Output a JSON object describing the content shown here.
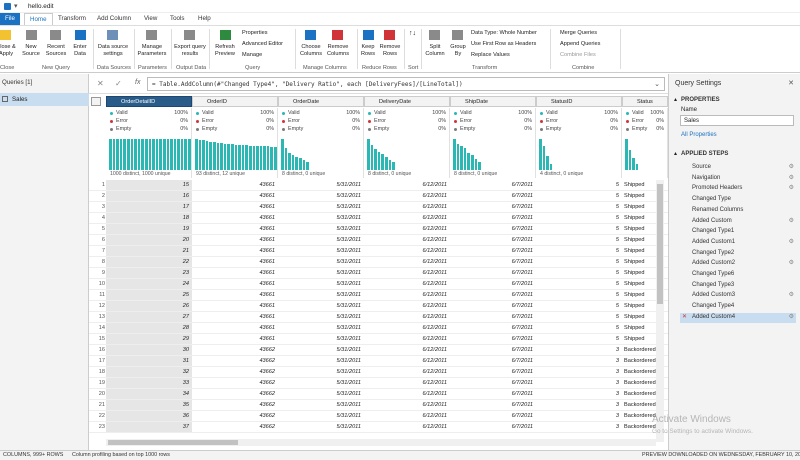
{
  "title": "hello.edit",
  "tabs": [
    "File",
    "Home",
    "Transform",
    "Add Column",
    "View",
    "Tools",
    "Help"
  ],
  "ribbon": {
    "buttons": [
      {
        "id": "close-apply",
        "label": "Close &\nApply"
      },
      {
        "id": "new-source",
        "label": "New\nSource"
      },
      {
        "id": "recent-sources",
        "label": "Recent\nSources"
      },
      {
        "id": "enter-data",
        "label": "Enter\nData"
      },
      {
        "id": "data-source-settings",
        "label": "Data source\nsettings"
      },
      {
        "id": "manage-parameters",
        "label": "Manage\nParameters"
      },
      {
        "id": "refresh-preview",
        "label": "Refresh\nPreview"
      },
      {
        "id": "export-query",
        "label": "Export query\nresults"
      },
      {
        "id": "choose-columns",
        "label": "Choose\nColumns"
      },
      {
        "id": "remove-columns",
        "label": "Remove\nColumns"
      },
      {
        "id": "keep-rows",
        "label": "Keep\nRows"
      },
      {
        "id": "remove-rows",
        "label": "Remove\nRows"
      },
      {
        "id": "split-column",
        "label": "Split\nColumn"
      },
      {
        "id": "group-by",
        "label": "Group\nBy"
      }
    ],
    "small": {
      "properties": "Properties",
      "advanced_editor": "Advanced Editor",
      "manage": "Manage",
      "data_type": "Data Type: Whole Number",
      "first_row": "Use First Row as Headers",
      "replace_values": "Replace Values",
      "merge": "Merge Queries",
      "append": "Append Queries",
      "combine_files": "Combine Files"
    },
    "groups": [
      "Close",
      "New Query",
      "Data Sources",
      "Parameters",
      "Output Data",
      "Query",
      "Manage Columns",
      "Reduce Rows",
      "Sort",
      "Transform",
      "Combine"
    ]
  },
  "queries": {
    "header": "Queries [1]",
    "items": [
      "Sales"
    ]
  },
  "formula": "= Table.AddColumn(#\"Changed Type4\", \"Delivery Ratio\", each [DeliveryFees]/[LineTotal])",
  "columns": [
    {
      "name": "OrderDetailID",
      "valid": "100%",
      "error": "0%",
      "empty": "0%",
      "foot": "1000 distinct, 1000 unique"
    },
    {
      "name": "OrderID",
      "valid": "100%",
      "error": "0%",
      "empty": "0%",
      "foot": "93 distinct, 12 unique"
    },
    {
      "name": "OrderDate",
      "valid": "100%",
      "error": "0%",
      "empty": "0%",
      "foot": "8 distinct, 0 unique"
    },
    {
      "name": "DeliveryDate",
      "valid": "100%",
      "error": "0%",
      "empty": "0%",
      "foot": "8 distinct, 0 unique"
    },
    {
      "name": "ShipDate",
      "valid": "100%",
      "error": "0%",
      "empty": "0%",
      "foot": "8 distinct, 0 unique"
    },
    {
      "name": "StatusID",
      "valid": "100%",
      "error": "0%",
      "empty": "0%",
      "foot": "4 distinct, 0 unique"
    },
    {
      "name": "Status",
      "valid": "100%",
      "error": "0%",
      "empty": "0%",
      "foot": "4 distinct, 0 unique"
    }
  ],
  "profile_labels": {
    "valid": "Valid",
    "error": "Error",
    "empty": "Empty"
  },
  "colors": {
    "valid": "#2bb7b3",
    "error": "#d13438",
    "empty": "#7a7a7a",
    "accent": "#1b72c2"
  },
  "histograms": [
    [
      31,
      31,
      31,
      31,
      31,
      31,
      31,
      31,
      31,
      31,
      31,
      31,
      31,
      31,
      31,
      31,
      31,
      31,
      31,
      31,
      31,
      31,
      31
    ],
    [
      31,
      30,
      30,
      29,
      28,
      28,
      27,
      27,
      26,
      26,
      26,
      25,
      25,
      25,
      25,
      24,
      24,
      24,
      24,
      24,
      24,
      23,
      23
    ],
    [
      31,
      22,
      17,
      15,
      13,
      12,
      10,
      8
    ],
    [
      31,
      25,
      21,
      18,
      16,
      13,
      10,
      8
    ],
    [
      31,
      26,
      24,
      22,
      17,
      15,
      11,
      8
    ],
    [
      31,
      24,
      14,
      6
    ],
    [
      31,
      20,
      12,
      6
    ]
  ],
  "rows": [
    [
      "15",
      "43661",
      "5/31/2011",
      "6/12/2011",
      "6/7/2011",
      "5",
      "Shipped"
    ],
    [
      "16",
      "43661",
      "5/31/2011",
      "6/12/2011",
      "6/7/2011",
      "5",
      "Shipped"
    ],
    [
      "17",
      "43661",
      "5/31/2011",
      "6/12/2011",
      "6/7/2011",
      "5",
      "Shipped"
    ],
    [
      "18",
      "43661",
      "5/31/2011",
      "6/12/2011",
      "6/7/2011",
      "5",
      "Shipped"
    ],
    [
      "19",
      "43661",
      "5/31/2011",
      "6/12/2011",
      "6/7/2011",
      "5",
      "Shipped"
    ],
    [
      "20",
      "43661",
      "5/31/2011",
      "6/12/2011",
      "6/7/2011",
      "5",
      "Shipped"
    ],
    [
      "21",
      "43661",
      "5/31/2011",
      "6/12/2011",
      "6/7/2011",
      "5",
      "Shipped"
    ],
    [
      "22",
      "43661",
      "5/31/2011",
      "6/12/2011",
      "6/7/2011",
      "5",
      "Shipped"
    ],
    [
      "23",
      "43661",
      "5/31/2011",
      "6/12/2011",
      "6/7/2011",
      "5",
      "Shipped"
    ],
    [
      "24",
      "43661",
      "5/31/2011",
      "6/12/2011",
      "6/7/2011",
      "5",
      "Shipped"
    ],
    [
      "25",
      "43661",
      "5/31/2011",
      "6/12/2011",
      "6/7/2011",
      "5",
      "Shipped"
    ],
    [
      "26",
      "43661",
      "5/31/2011",
      "6/12/2011",
      "6/7/2011",
      "5",
      "Shipped"
    ],
    [
      "27",
      "43661",
      "5/31/2011",
      "6/12/2011",
      "6/7/2011",
      "5",
      "Shipped"
    ],
    [
      "28",
      "43661",
      "5/31/2011",
      "6/12/2011",
      "6/7/2011",
      "5",
      "Shipped"
    ],
    [
      "29",
      "43661",
      "5/31/2011",
      "6/12/2011",
      "6/7/2011",
      "5",
      "Shipped"
    ],
    [
      "30",
      "43662",
      "5/31/2011",
      "6/12/2011",
      "6/7/2011",
      "3",
      "Backordered"
    ],
    [
      "31",
      "43662",
      "5/31/2011",
      "6/12/2011",
      "6/7/2011",
      "3",
      "Backordered"
    ],
    [
      "32",
      "43662",
      "5/31/2011",
      "6/12/2011",
      "6/7/2011",
      "3",
      "Backordered"
    ],
    [
      "33",
      "43662",
      "5/31/2011",
      "6/12/2011",
      "6/7/2011",
      "3",
      "Backordered"
    ],
    [
      "34",
      "43662",
      "5/31/2011",
      "6/12/2011",
      "6/7/2011",
      "3",
      "Backordered"
    ],
    [
      "35",
      "43662",
      "5/31/2011",
      "6/12/2011",
      "6/7/2011",
      "3",
      "Backordered"
    ],
    [
      "36",
      "43662",
      "5/31/2011",
      "6/12/2011",
      "6/7/2011",
      "3",
      "Backordered"
    ],
    [
      "37",
      "43662",
      "5/31/2011",
      "6/12/2011",
      "6/7/2011",
      "3",
      "Backordered"
    ]
  ],
  "settings": {
    "title": "Query Settings",
    "properties_header": "PROPERTIES",
    "name_label": "Name",
    "name_value": "Sales",
    "all_properties": "All Properties",
    "steps_header": "APPLIED STEPS",
    "steps": [
      "Source",
      "Navigation",
      "Promoted Headers",
      "Changed Type",
      "Renamed Columns",
      "Added Custom",
      "Changed Type1",
      "Added Custom1",
      "Changed Type2",
      "Added Custom2",
      "Changed Type6",
      "Changed Type3",
      "Added Custom3",
      "Changed Type4",
      "Added Custom4"
    ]
  },
  "status": {
    "left": "COLUMNS, 999+ ROWS",
    "middle": "Column profiling based on top 1000 rows",
    "right": "PREVIEW DOWNLOADED ON WEDNESDAY, FEBRUARY 10, 20",
    "watermark1": "Activate Windows",
    "watermark2": "Go to Settings to activate Windows."
  }
}
